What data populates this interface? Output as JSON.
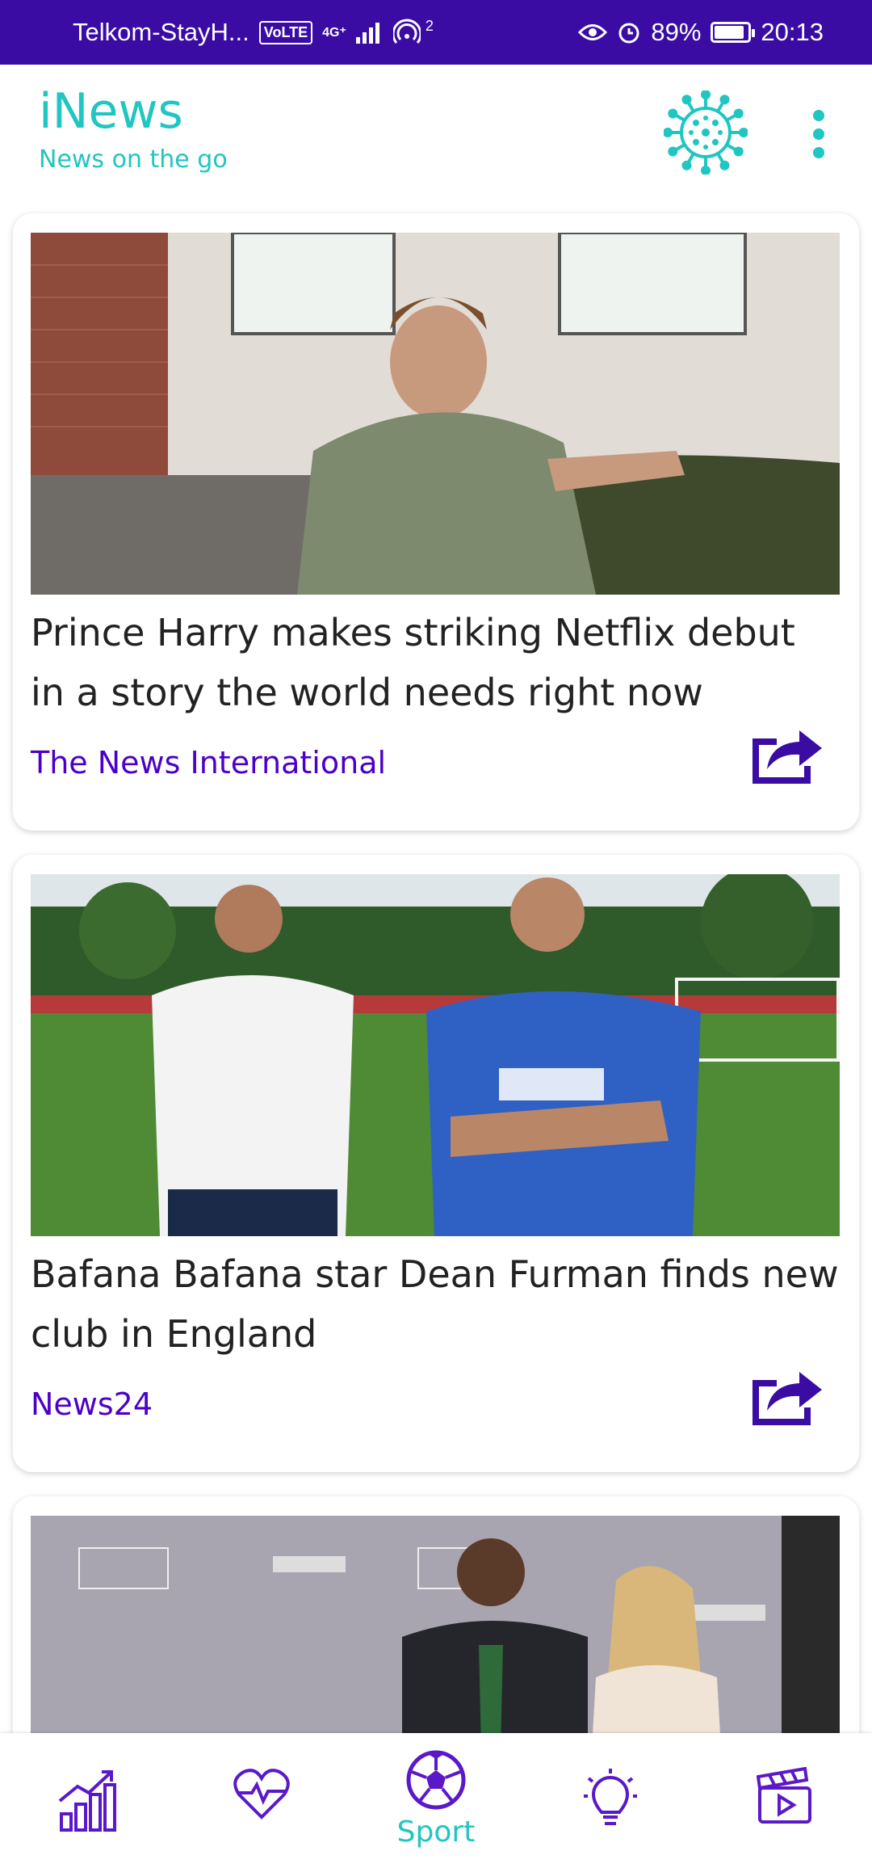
{
  "status_bar": {
    "carrier": "Telkom-StayH...",
    "volte": "VoLTE",
    "network": "4G⁺",
    "hotspot_count": "2",
    "battery": "89%",
    "battery_level": 0.89,
    "time": "20:13"
  },
  "app": {
    "title": "iNews",
    "subtitle": "News on the go",
    "colors": {
      "accent": "#1fc6c2",
      "primary": "#3a0ca3",
      "source": "#4b00c9"
    },
    "covid_icon": "virus-icon",
    "menu_icon": "more-vert-icon"
  },
  "articles": [
    {
      "title": "Prince Harry makes striking Netflix debut in a story the world needs right now",
      "source": "The News International",
      "image": "man-on-green-sofa",
      "share_icon": "share-icon"
    },
    {
      "title": "Bafana Bafana star Dean Furman finds new club in England",
      "source": "News24",
      "image": "two-men-on-football-pitch",
      "share_icon": "share-icon"
    },
    {
      "title": "",
      "source": "",
      "image": "couple-at-awards-event",
      "share_icon": "share-icon"
    }
  ],
  "bottom_nav": {
    "items": [
      {
        "icon": "chart-icon",
        "label": ""
      },
      {
        "icon": "heartbeat-icon",
        "label": ""
      },
      {
        "icon": "soccer-ball-icon",
        "label": "Sport",
        "active": true
      },
      {
        "icon": "lightbulb-icon",
        "label": ""
      },
      {
        "icon": "clapperboard-icon",
        "label": ""
      }
    ]
  }
}
